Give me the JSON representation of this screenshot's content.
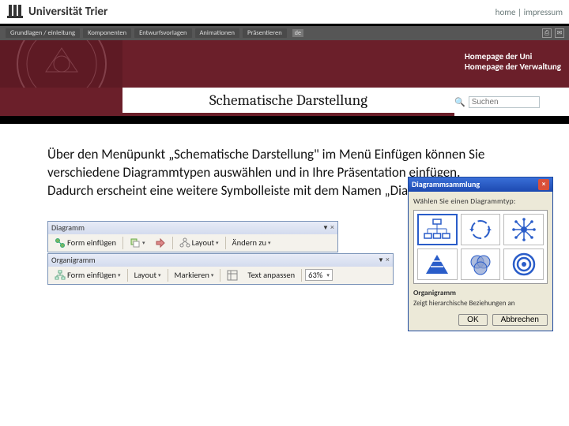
{
  "header": {
    "logo_text": "Universität Trier",
    "toplinks": {
      "home": "home",
      "sep": " | ",
      "impressum": "impressum"
    }
  },
  "nav": {
    "items": [
      "Grundlagen / einleitung",
      "Komponenten",
      "Entwurfsvorlagen",
      "Animationen",
      "Präsentieren"
    ],
    "lang": "de"
  },
  "maroon_links": {
    "l1": "Homepage der Uni",
    "l2": "Homepage der Verwaltung"
  },
  "title": "Schematische Darstellung",
  "search": {
    "placeholder": "Suchen"
  },
  "body_text": "Über den Menüpunkt „Schematische Darstellung“ im Menü Einfügen können Sie verschiedene Diagrammtypen auswählen und in Ihre Präsentation einfügen.\nDadurch erscheint eine weitere Symbolleiste mit dem Namen „Diagramm“.",
  "tb1": {
    "title": "Diagramm",
    "insert": "Form einfügen",
    "layout": "Layout",
    "change": "Ändern zu"
  },
  "tb2": {
    "title": "Organigramm",
    "insert": "Form einfügen",
    "layout": "Layout",
    "mark": "Markieren",
    "fit": "Text anpassen",
    "zoom": "63%"
  },
  "dlg": {
    "title": "Diagrammsammlung",
    "label": "Wählen Sie einen Diagrammtyp:",
    "desc_title": "Organigramm",
    "desc": "Zeigt hierarchische Beziehungen an",
    "ok": "OK",
    "cancel": "Abbrechen"
  }
}
